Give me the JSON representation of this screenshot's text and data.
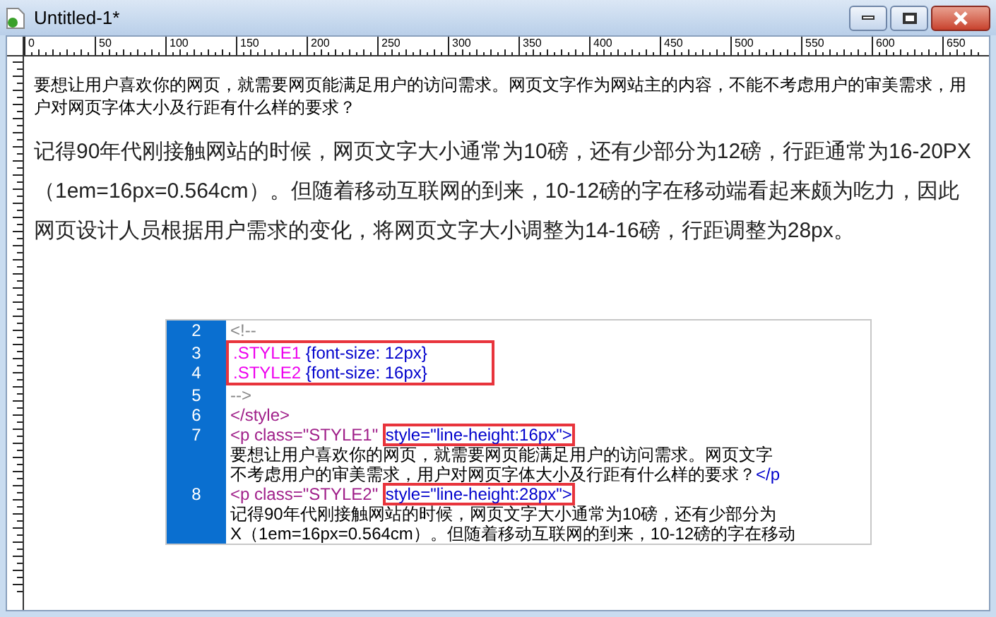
{
  "window": {
    "title": "Untitled-1*"
  },
  "ruler": {
    "labels": [
      "0",
      "50",
      "100",
      "150",
      "200",
      "250",
      "300",
      "350",
      "400",
      "450",
      "500",
      "550",
      "600",
      "650"
    ]
  },
  "document": {
    "intro": "要想让用户喜欢你的网页，就需要网页能满足用户的访问需求。网页文字作为网站主的内容，不能不考虑用户的审美需求，用户对网页字体大小及行距有什么样的要求？",
    "body": "记得90年代刚接触网站的时候，网页文字大小通常为10磅，还有少部分为12磅，行距通常为16-20PX（1em=16px=0.564cm）。但随着移动互联网的到来，10-12磅的字在移动端看起来颇为吃力，因此网页设计人员根据用户需求的变化，将网页文字大小调整为14-16磅，行距调整为28px。"
  },
  "code_view": {
    "lines": [
      {
        "number": "2",
        "boxed": false,
        "segments": [
          {
            "kind": "comment",
            "text": "<!--",
            "boxed": false
          }
        ]
      },
      {
        "number": "3",
        "boxed": true,
        "segments": [
          {
            "kind": "selector",
            "text": ".STYLE1 ",
            "boxed": false
          },
          {
            "kind": "rule",
            "text": "{font-size: 12px}",
            "boxed": false
          }
        ]
      },
      {
        "number": "4",
        "boxed": true,
        "segments": [
          {
            "kind": "selector",
            "text": ".STYLE2 ",
            "boxed": false
          },
          {
            "kind": "rule",
            "text": "{font-size: 16px}",
            "boxed": false
          }
        ]
      },
      {
        "number": "5",
        "boxed": false,
        "segments": [
          {
            "kind": "comment",
            "text": "-->",
            "boxed": false
          }
        ]
      },
      {
        "number": "6",
        "boxed": false,
        "segments": [
          {
            "kind": "tag",
            "text": "</style>",
            "boxed": false
          }
        ]
      },
      {
        "number": "7",
        "boxed": false,
        "segments": [
          {
            "kind": "tag",
            "text": "<p class=\"STYLE1\" ",
            "boxed": false
          },
          {
            "kind": "attr",
            "text": "style=\"line-height:16px\">",
            "boxed": true
          }
        ]
      },
      {
        "boxed": false,
        "segments": [
          {
            "kind": "text",
            "text": "要想让用户喜欢你的网页，就需要网页能满足用户的访问需求。网页文字",
            "boxed": false
          }
        ]
      },
      {
        "boxed": false,
        "segments": [
          {
            "kind": "text",
            "text": "不考虑用户的审美需求，用户对网页字体大小及行距有什么样的要求？",
            "boxed": false
          },
          {
            "kind": "attr",
            "text": "</p",
            "boxed": false
          }
        ]
      },
      {
        "number": "8",
        "boxed": false,
        "segments": [
          {
            "kind": "tag",
            "text": "<p class=\"STYLE2\" ",
            "boxed": false
          },
          {
            "kind": "attr",
            "text": "style=\"line-height:28px\">",
            "boxed": true
          }
        ]
      },
      {
        "boxed": false,
        "segments": [
          {
            "kind": "text",
            "text": "记得90年代刚接触网站的时候，网页文字大小通常为10磅，还有少部分为",
            "boxed": false
          }
        ]
      },
      {
        "boxed": false,
        "segments": [
          {
            "kind": "text",
            "text": "X（1em=16px=0.564cm）。但随着移动互联网的到来，10-12磅的字在移动",
            "boxed": false
          }
        ]
      }
    ]
  }
}
